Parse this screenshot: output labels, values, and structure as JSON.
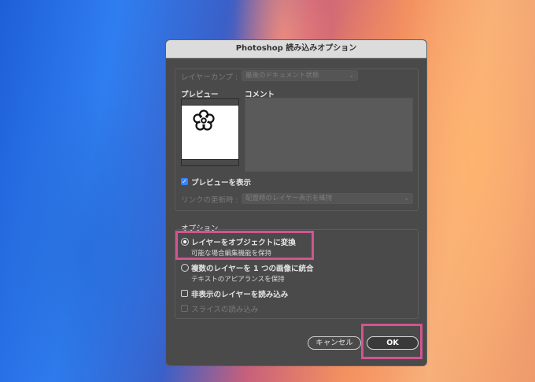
{
  "dialog": {
    "title": "Photoshop 読み込みオプション"
  },
  "layer_comp": {
    "label": "レイヤーカンプ :",
    "value": "最後のドキュメント状態"
  },
  "preview": {
    "label": "プレビュー",
    "show_label": "プレビューを表示",
    "show_checked": true
  },
  "comment": {
    "label": "コメント"
  },
  "link_update": {
    "label": "リンクの更新時 :",
    "value": "配置時のレイヤー表示を維持"
  },
  "options": {
    "label": "オプション",
    "convert_layers": {
      "label": "レイヤーをオブジェクトに変換",
      "sub": "可能な場合編集機能を保持",
      "selected": true
    },
    "flatten": {
      "label": "複数のレイヤーを 1 つの画像に統合",
      "sub": "テキストのアピアランスを保持",
      "selected": false
    },
    "hidden_layers": {
      "label": "非表示のレイヤーを読み込み",
      "checked": false
    },
    "slices": {
      "label": "スライスの読み込み",
      "checked": false,
      "disabled": true
    }
  },
  "buttons": {
    "cancel": "キャンセル",
    "ok": "OK"
  },
  "colors": {
    "highlight": "#d2548f",
    "checkbox_accent": "#3b82f6",
    "dialog_bg": "#4a4a4a"
  }
}
